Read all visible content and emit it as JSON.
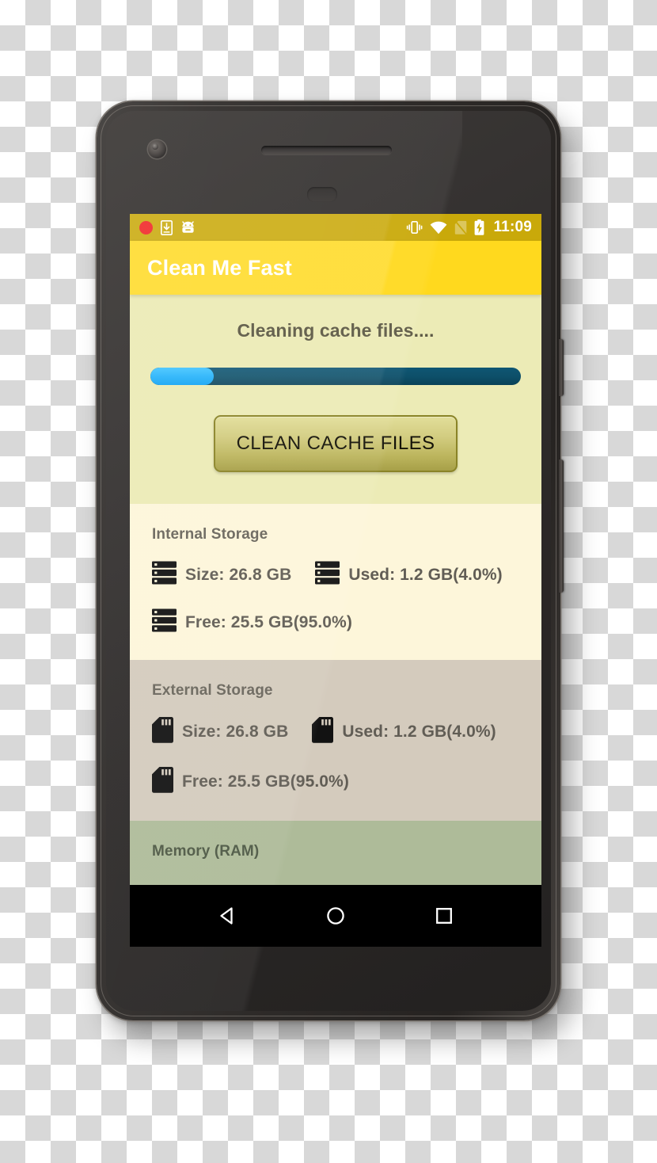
{
  "app": {
    "title": "Clean Me Fast",
    "brand_color": "#ffd91e"
  },
  "status_bar": {
    "background_color": "#c9a90a",
    "clock": "11:09",
    "left_icons": [
      {
        "name": "screen-record-dot-icon",
        "color": "#f02222"
      },
      {
        "name": "download-to-device-icon"
      },
      {
        "name": "android-head-icon"
      }
    ],
    "right_icons": [
      {
        "name": "vibrate-mode-icon"
      },
      {
        "name": "wifi-icon"
      },
      {
        "name": "no-sim-card-icon"
      },
      {
        "name": "battery-charging-icon"
      }
    ]
  },
  "clean_panel": {
    "background_color": "#ecebb6",
    "status_text": "Cleaning cache files....",
    "progress": {
      "percent": 17,
      "fill_color": "#21b2fb",
      "track_color": "#0d4f69"
    },
    "button_label": "CLEAN CACHE FILES"
  },
  "sections": [
    {
      "id": "internal-storage",
      "title": "Internal Storage",
      "background_color": "#fdf6da",
      "icon": "server-stack-icon",
      "rows": [
        [
          {
            "label": "Size: 26.8 GB"
          },
          {
            "label": "Used: 1.2 GB(4.0%)"
          }
        ],
        [
          {
            "label": "Free: 25.5 GB(95.0%)"
          }
        ]
      ]
    },
    {
      "id": "external-storage",
      "title": "External Storage",
      "background_color": "#d4cbbd",
      "icon": "sd-card-icon",
      "rows": [
        [
          {
            "label": "Size: 26.8 GB"
          },
          {
            "label": "Used: 1.2 GB(4.0%)"
          }
        ],
        [
          {
            "label": "Free: 25.5 GB(95.0%)"
          }
        ]
      ]
    },
    {
      "id": "memory-ram",
      "title": "Memory (RAM)",
      "background_color": "#aebb99",
      "icon": "memory-chip-icon",
      "rows": []
    }
  ],
  "nav_bar": {
    "background_color": "#000000",
    "buttons": [
      {
        "name": "back-button"
      },
      {
        "name": "home-button"
      },
      {
        "name": "recents-button"
      }
    ]
  }
}
